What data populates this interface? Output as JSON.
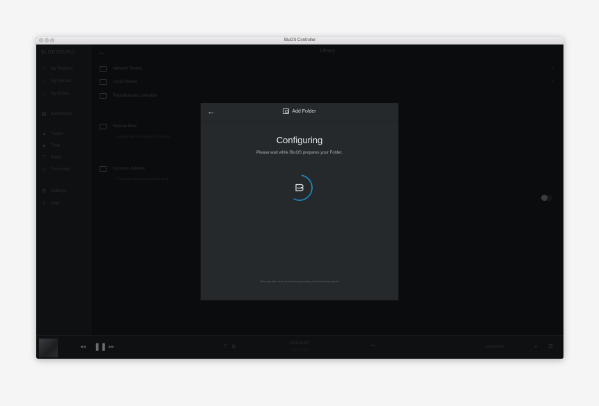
{
  "window": {
    "title": "BluOS Controller"
  },
  "sidebar": {
    "brand": "BLUESOUND",
    "items": [
      {
        "icon": "home-icon",
        "glyph": "⌂",
        "label": "My Playlists"
      },
      {
        "icon": "star-icon",
        "glyph": "☆",
        "label": "My Albums"
      },
      {
        "icon": "star-icon",
        "glyph": "☆",
        "label": "My Artists"
      },
      {
        "icon": "book-icon",
        "glyph": "▤",
        "label": "Audiobooks"
      },
      {
        "icon": "radio-icon",
        "glyph": "◂",
        "label": "TuneIn"
      },
      {
        "icon": "circle-icon",
        "glyph": "●",
        "label": "Tidal"
      },
      {
        "icon": "antenna-icon",
        "glyph": "⊤",
        "label": "Radio"
      },
      {
        "icon": "diamond-icon",
        "glyph": "◇",
        "label": "Favourites"
      },
      {
        "icon": "gear-icon",
        "glyph": "⚙",
        "label": "Settings"
      },
      {
        "icon": "help-icon",
        "glyph": "?",
        "label": "Help"
      }
    ]
  },
  "main": {
    "back_glyph": "←",
    "title": "Library",
    "rows": [
      {
        "label": "Network Shares",
        "chevron": "›"
      },
      {
        "label": "Local Shares",
        "chevron": "›"
      },
      {
        "label": "Rebuild music collection",
        "chevron": ""
      },
      {
        "label": "Rescan Now",
        "chevron": ""
      },
      {
        "label": "Common Artwork",
        "chevron": ""
      }
    ],
    "subtexts": [
      "Library indexing status information",
      "Common artwork description text"
    ]
  },
  "player": {
    "prev_glyph": "◂◂",
    "pause_glyph": "❚❚",
    "next_glyph": "▸▸",
    "title": "VOCALIST",
    "subtitle": "Album · Artist",
    "more_glyph": "•••",
    "source": "Living Room",
    "volume_glyph": "◖",
    "queue_glyph": "☰"
  },
  "dialog": {
    "back_glyph": "←",
    "title": "Add Folder",
    "heading": "Configuring",
    "message": "Please wait while BluOS prepares your Folder.",
    "note": "This may take several minutes depending on the network speed.",
    "accent_color": "#1f8ecb"
  }
}
